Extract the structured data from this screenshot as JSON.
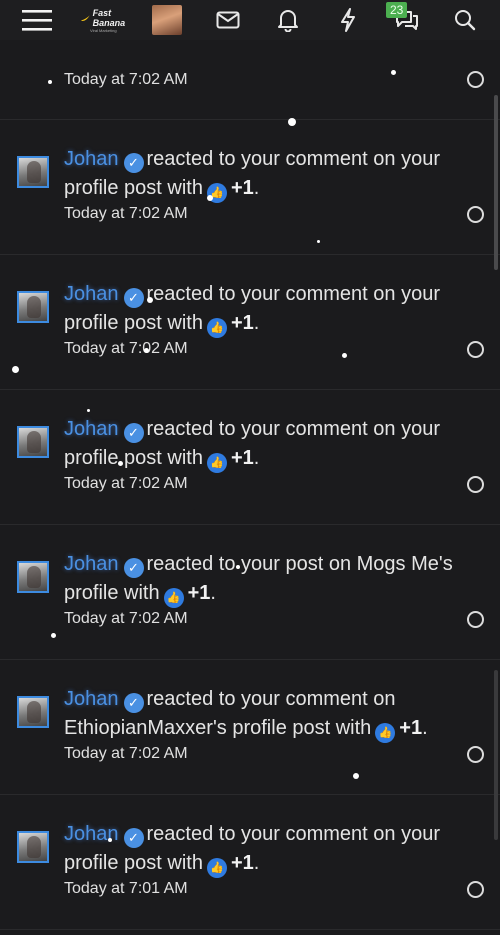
{
  "topbar": {
    "logo_text": "Fast Banana",
    "logo_sub": "Viral Marketing",
    "chat_badge": "23",
    "icons": [
      "menu-icon",
      "mail-icon",
      "bell-icon",
      "bolt-icon",
      "chat-icon",
      "search-icon"
    ]
  },
  "first_time": "Today at 7:02 AM",
  "notifications": [
    {
      "name": "Johan",
      "text": "reacted to your comment on your profile post with",
      "reaction": "+1",
      "time": "Today at 7:02 AM"
    },
    {
      "name": "Johan",
      "text": "reacted to your comment on your profile post with",
      "reaction": "+1",
      "time": "Today at 7:02 AM"
    },
    {
      "name": "Johan",
      "text": "reacted to your comment on your profile post with",
      "reaction": "+1",
      "time": "Today at 7:02 AM"
    },
    {
      "name": "Johan",
      "text": "reacted to your post on Mogs Me's profile with",
      "reaction": "+1",
      "time": "Today at 7:02 AM"
    },
    {
      "name": "Johan",
      "text": "reacted to your comment on EthiopianMaxxer's profile post with",
      "reaction": "+1",
      "time": "Today at 7:02 AM"
    },
    {
      "name": "Johan",
      "text": "reacted to your comment on your profile post with",
      "reaction": "+1",
      "time": "Today at 7:01 AM"
    }
  ],
  "colors": {
    "background": "#1b1b1d",
    "accent": "#4a90e2",
    "badge": "#4caf50"
  }
}
